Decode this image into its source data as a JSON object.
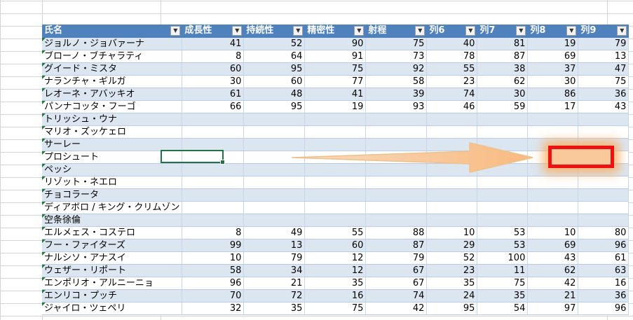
{
  "columns": [
    {
      "label": "氏名"
    },
    {
      "label": "成長性"
    },
    {
      "label": "持続性"
    },
    {
      "label": "精密性"
    },
    {
      "label": "射程"
    },
    {
      "label": "列6"
    },
    {
      "label": "列7"
    },
    {
      "label": "列8"
    },
    {
      "label": "列9"
    }
  ],
  "filter_icon": "dropdown-arrow-icon",
  "rows": [
    {
      "name": "ジョルノ・ジョバァーナ",
      "values": [
        "41",
        "52",
        "90",
        "75",
        "40",
        "81",
        "19",
        "79"
      ]
    },
    {
      "name": "ブローノ・ブチャラティ",
      "values": [
        "8",
        "64",
        "91",
        "73",
        "78",
        "87",
        "69",
        "13"
      ]
    },
    {
      "name": "グイード・ミスタ",
      "values": [
        "60",
        "95",
        "75",
        "92",
        "55",
        "38",
        "37",
        "47"
      ]
    },
    {
      "name": "ナランチャ・ギルガ",
      "values": [
        "30",
        "60",
        "77",
        "58",
        "23",
        "62",
        "30",
        "75"
      ]
    },
    {
      "name": "レオーネ・アバッキオ",
      "values": [
        "61",
        "48",
        "41",
        "39",
        "74",
        "30",
        "86",
        "36"
      ]
    },
    {
      "name": "パンナコッタ・フーゴ",
      "values": [
        "66",
        "95",
        "19",
        "93",
        "46",
        "59",
        "17",
        "43"
      ]
    },
    {
      "name": "トリッシュ・ウナ",
      "values": [
        "",
        "",
        "",
        "",
        "",
        "",
        "",
        ""
      ]
    },
    {
      "name": "マリオ・ズッケェロ",
      "values": [
        "",
        "",
        "",
        "",
        "",
        "",
        "",
        ""
      ]
    },
    {
      "name": "サーレー",
      "values": [
        "",
        "",
        "",
        "",
        "",
        "",
        "",
        ""
      ]
    },
    {
      "name": "プロシュート",
      "values": [
        "",
        "",
        "",
        "",
        "",
        "",
        "",
        ""
      ]
    },
    {
      "name": "ペッシ",
      "values": [
        "",
        "",
        "",
        "",
        "",
        "",
        "",
        ""
      ]
    },
    {
      "name": "リゾット・ネエロ",
      "values": [
        "",
        "",
        "",
        "",
        "",
        "",
        "",
        ""
      ]
    },
    {
      "name": "チョコラータ",
      "values": [
        "",
        "",
        "",
        "",
        "",
        "",
        "",
        ""
      ]
    },
    {
      "name": "ディアボロ / キング・クリムゾン",
      "values": [
        "",
        "",
        "",
        "",
        "",
        "",
        "",
        ""
      ]
    },
    {
      "name": "空条徐倫",
      "values": [
        "",
        "",
        "",
        "",
        "",
        "",
        "",
        ""
      ]
    },
    {
      "name": "エルメェス・コステロ",
      "values": [
        "8",
        "49",
        "55",
        "88",
        "10",
        "53",
        "10",
        "80"
      ]
    },
    {
      "name": "フー・ファイターズ",
      "values": [
        "99",
        "13",
        "60",
        "87",
        "29",
        "53",
        "69",
        "96"
      ]
    },
    {
      "name": "ナルシソ・アナスイ",
      "values": [
        "10",
        "79",
        "12",
        "79",
        "52",
        "100",
        "43",
        "61"
      ]
    },
    {
      "name": "ウェザー・リポート",
      "values": [
        "58",
        "34",
        "12",
        "67",
        "23",
        "11",
        "62",
        "63"
      ]
    },
    {
      "name": "エンポリオ・アルニーニョ",
      "values": [
        "96",
        "21",
        "35",
        "67",
        "35",
        "75",
        "42",
        "16"
      ]
    },
    {
      "name": "エンリコ・プッチ",
      "values": [
        "70",
        "72",
        "16",
        "74",
        "24",
        "35",
        "21",
        "36"
      ]
    },
    {
      "name": "ジャイロ・ツェペリ",
      "values": [
        "32",
        "35",
        "75",
        "42",
        "95",
        "54",
        "97",
        "96"
      ]
    }
  ]
}
